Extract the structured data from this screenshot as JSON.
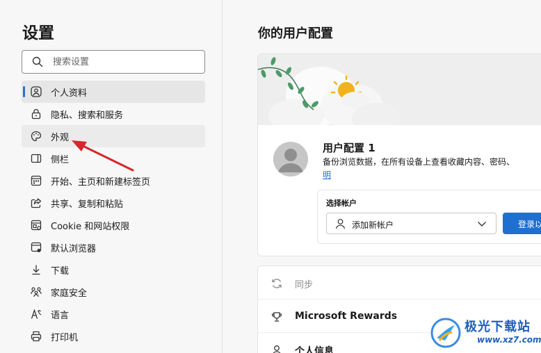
{
  "sidebar": {
    "title": "设置",
    "search": {
      "placeholder": "搜索设置",
      "value": ""
    },
    "items": [
      {
        "id": "profile",
        "label": "个人资料",
        "icon": "person-circle-icon",
        "active": true
      },
      {
        "id": "privacy",
        "label": "隐私、搜索和服务",
        "icon": "lock-icon"
      },
      {
        "id": "appearance",
        "label": "外观",
        "icon": "palette-icon",
        "hover": true
      },
      {
        "id": "sidebar",
        "label": "侧栏",
        "icon": "sidebar-panel-icon"
      },
      {
        "id": "start",
        "label": "开始、主页和新建标签页",
        "icon": "home-grid-icon"
      },
      {
        "id": "share",
        "label": "共享、复制和粘贴",
        "icon": "share-icon"
      },
      {
        "id": "cookies",
        "label": "Cookie 和网站权限",
        "icon": "site-permissions-icon"
      },
      {
        "id": "default-browser",
        "label": "默认浏览器",
        "icon": "browser-icon"
      },
      {
        "id": "downloads",
        "label": "下载",
        "icon": "download-icon"
      },
      {
        "id": "family",
        "label": "家庭安全",
        "icon": "family-icon"
      },
      {
        "id": "languages",
        "label": "语言",
        "icon": "language-icon"
      },
      {
        "id": "printers",
        "label": "打印机",
        "icon": "printer-icon"
      }
    ]
  },
  "main": {
    "title": "你的用户配置",
    "profile": {
      "name": "用户配置 1",
      "description": "备份浏览数据，在所有设备上查看收藏内容、密码、",
      "link": "明"
    },
    "account": {
      "label": "选择帐户",
      "selected": "添加新帐户",
      "signin_button": "登录以"
    },
    "list": [
      {
        "id": "sync",
        "label": "同步",
        "icon": "sync-icon",
        "disabled": true
      },
      {
        "id": "rewards",
        "label": "Microsoft Rewards",
        "icon": "trophy-icon"
      },
      {
        "id": "personal-info",
        "label": "个人信息",
        "icon": "person-icon"
      }
    ]
  },
  "watermark": {
    "title": "极光下载站",
    "url": "www.xz7.com"
  },
  "colors": {
    "accent": "#1f6fd0",
    "annotation_arrow": "#d7262c",
    "active_indicator": "#2f6fd1"
  }
}
